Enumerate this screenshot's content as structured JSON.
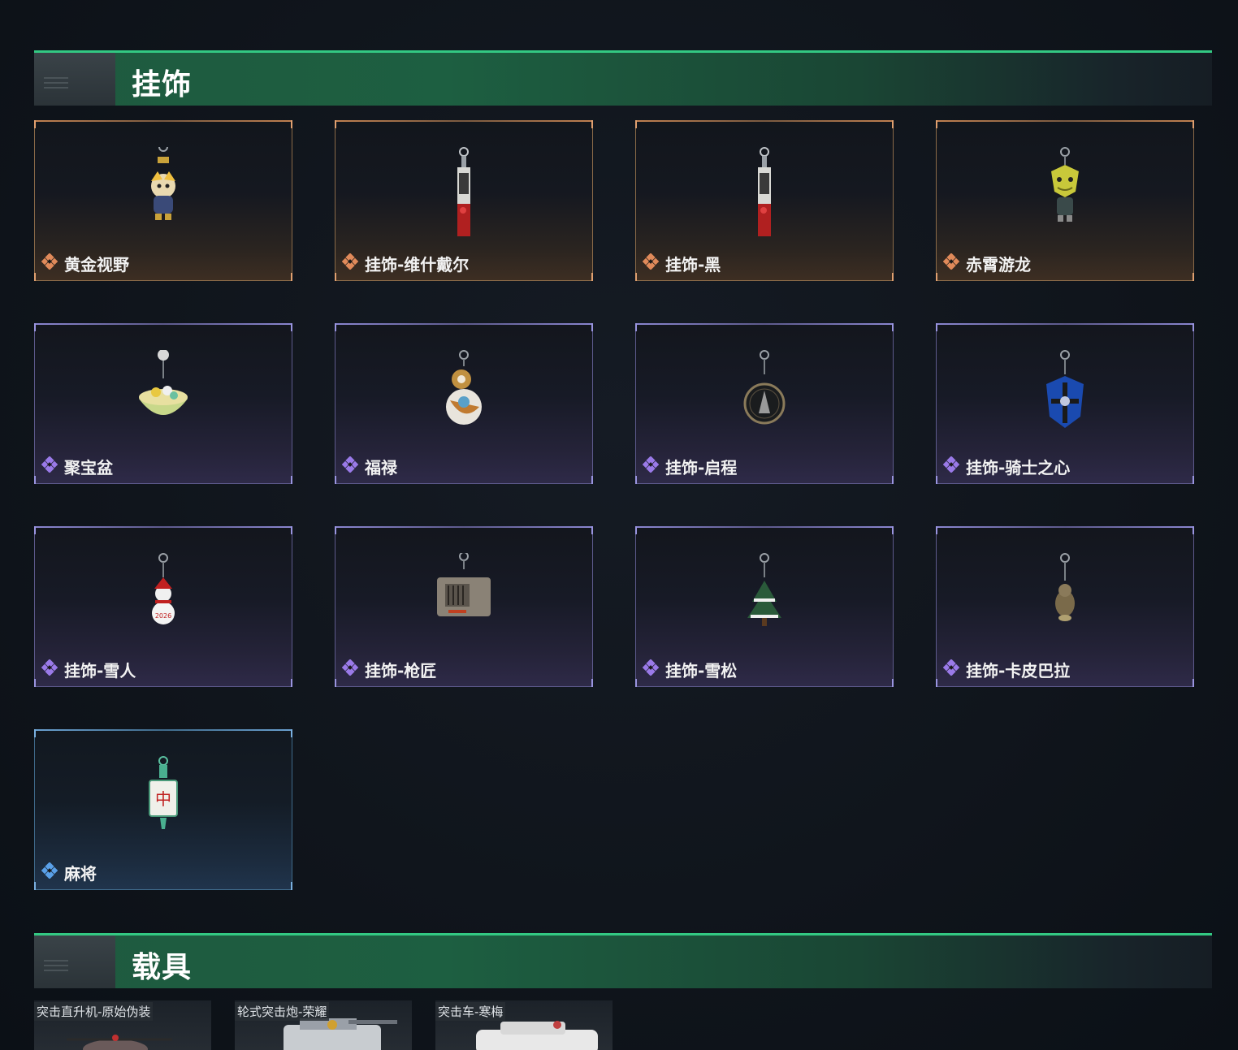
{
  "sections": {
    "pendants": {
      "title": "挂饰"
    },
    "vehicles": {
      "title": "载具"
    }
  },
  "colors": {
    "header_accent": "#33c983",
    "rarity_gold": "#e08a5a",
    "rarity_purple": "#9a7ae8",
    "rarity_blue": "#5aa0e8"
  },
  "pendants": [
    {
      "name": "黄金视野",
      "rarity": "gold",
      "icon": "pendant-golden-figure-icon"
    },
    {
      "name": "挂饰-维什戴尔",
      "rarity": "gold",
      "icon": "pendant-red-tag-icon"
    },
    {
      "name": "挂饰-黑",
      "rarity": "gold",
      "icon": "pendant-red-tag-icon"
    },
    {
      "name": "赤霄游龙",
      "rarity": "gold",
      "icon": "pendant-dragon-icon"
    },
    {
      "name": "聚宝盆",
      "rarity": "purple",
      "icon": "pendant-treasure-bowl-icon"
    },
    {
      "name": "福禄",
      "rarity": "purple",
      "icon": "pendant-gourd-icon"
    },
    {
      "name": "挂饰-启程",
      "rarity": "purple",
      "icon": "pendant-medal-icon"
    },
    {
      "name": "挂饰-骑士之心",
      "rarity": "purple",
      "icon": "pendant-blue-shield-icon"
    },
    {
      "name": "挂饰-雪人",
      "rarity": "purple",
      "icon": "pendant-snowman-icon"
    },
    {
      "name": "挂饰-枪匠",
      "rarity": "purple",
      "icon": "pendant-crate-icon"
    },
    {
      "name": "挂饰-雪松",
      "rarity": "purple",
      "icon": "pendant-pine-tree-icon"
    },
    {
      "name": "挂饰-卡皮巴拉",
      "rarity": "purple",
      "icon": "pendant-capybara-icon"
    },
    {
      "name": "麻将",
      "rarity": "blue",
      "icon": "pendant-mahjong-tile-icon"
    }
  ],
  "vehicles": [
    {
      "name": "突击直升机-原始伪装",
      "icon": "helicopter-icon"
    },
    {
      "name": "轮式突击炮-荣耀",
      "icon": "assault-gun-vehicle-icon"
    },
    {
      "name": "突击车-寒梅",
      "icon": "assault-car-icon"
    }
  ]
}
